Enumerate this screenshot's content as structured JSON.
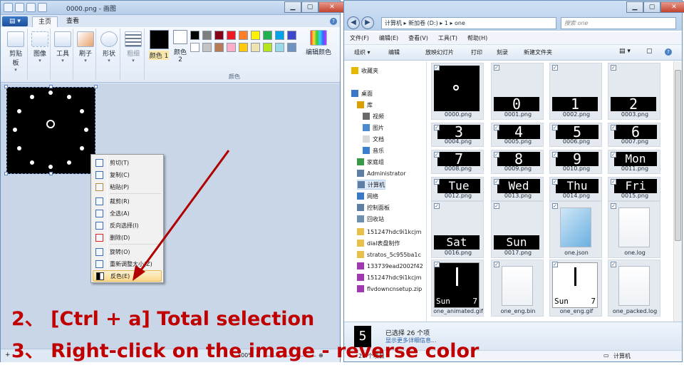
{
  "paint": {
    "title": "0000.png - 画图",
    "tabs": {
      "file": "",
      "home": "主页",
      "view": "查看"
    },
    "ribbon": {
      "clipboard": "剪贴板",
      "image": "图像",
      "tools": "工具",
      "brushes": "刷子",
      "shapes": "形状",
      "size": "粗细",
      "color1": "颜色 1",
      "color2": "颜色 2",
      "edit_colors": "编辑颜色",
      "colors_group": "颜色"
    },
    "palette": [
      "#000000",
      "#7f7f7f",
      "#880015",
      "#ed1c24",
      "#ff7f27",
      "#fff200",
      "#22b14c",
      "#00a2e8",
      "#3f48cc",
      "#ffffff",
      "#c3c3c3",
      "#b97a57",
      "#ffaec9",
      "#ffc90e",
      "#efe4b0",
      "#b5e61d",
      "#99d9ea",
      "#7092be"
    ],
    "status_zoom": "100%",
    "context_menu": [
      {
        "label": "剪切(T)",
        "icon": "scissors-icon"
      },
      {
        "label": "复制(C)",
        "icon": "copy-icon"
      },
      {
        "label": "粘贴(P)",
        "icon": "paste-icon"
      },
      {
        "label": "裁剪(R)",
        "icon": "crop-icon"
      },
      {
        "label": "全选(A)",
        "icon": "select-all-icon"
      },
      {
        "label": "反向选择(I)",
        "icon": "invert-selection-icon"
      },
      {
        "label": "删除(D)",
        "icon": "delete-icon"
      },
      {
        "label": "旋转(O)",
        "icon": "rotate-icon"
      },
      {
        "label": "重新调整大小(Z)",
        "icon": "resize-icon"
      },
      {
        "label": "反色(E)",
        "icon": "invert-color-icon"
      }
    ]
  },
  "explorer": {
    "address": "计算机 ▸ 新加卷 (D:) ▸ 1 ▸ one",
    "search_placeholder": "搜索 one",
    "menu": [
      "文件(F)",
      "编辑(E)",
      "查看(V)",
      "工具(T)",
      "帮助(H)"
    ],
    "toolbar": [
      "组织 ▾",
      "编辑",
      "放映幻灯片",
      "打印",
      "刻录",
      "新建文件夹"
    ],
    "nav": [
      {
        "label": "收藏夹",
        "indent": 0
      },
      {
        "label": "桌面",
        "indent": 0
      },
      {
        "label": "库",
        "indent": 1
      },
      {
        "label": "视频",
        "indent": 2
      },
      {
        "label": "图片",
        "indent": 2
      },
      {
        "label": "文档",
        "indent": 2
      },
      {
        "label": "音乐",
        "indent": 2
      },
      {
        "label": "家庭组",
        "indent": 1
      },
      {
        "label": "Administrator",
        "indent": 1
      },
      {
        "label": "计算机",
        "indent": 1
      },
      {
        "label": "网络",
        "indent": 1
      },
      {
        "label": "控制面板",
        "indent": 1
      },
      {
        "label": "回收站",
        "indent": 1
      },
      {
        "label": "151247hdc9i1kcjm",
        "indent": 1
      },
      {
        "label": "dial表盘制作",
        "indent": 1
      },
      {
        "label": "stratos_5c955ba1c",
        "indent": 1
      },
      {
        "label": "133739ead2002f42",
        "indent": 1
      },
      {
        "label": "151247hdc9i1kcjm",
        "indent": 1
      },
      {
        "label": "flvdowncnsetup.zip",
        "indent": 1
      }
    ],
    "files": [
      {
        "name": "0000.png",
        "thumb": ""
      },
      {
        "name": "0001.png",
        "thumb": "0"
      },
      {
        "name": "0002.png",
        "thumb": "1"
      },
      {
        "name": "0003.png",
        "thumb": "2"
      },
      {
        "name": "0004.png",
        "thumb": "3"
      },
      {
        "name": "0005.png",
        "thumb": "4"
      },
      {
        "name": "0006.png",
        "thumb": "5"
      },
      {
        "name": "0007.png",
        "thumb": "6"
      },
      {
        "name": "0008.png",
        "thumb": "7"
      },
      {
        "name": "0009.png",
        "thumb": "8"
      },
      {
        "name": "0010.png",
        "thumb": "9"
      },
      {
        "name": "0011.png",
        "thumb": "Mon"
      },
      {
        "name": "0012.png",
        "thumb": "Tue"
      },
      {
        "name": "0013.png",
        "thumb": "Wed"
      },
      {
        "name": "0014.png",
        "thumb": "Thu"
      },
      {
        "name": "0015.png",
        "thumb": "Fri"
      },
      {
        "name": "0016.png",
        "thumb": "Sat"
      },
      {
        "name": "0017.png",
        "thumb": "Sun"
      },
      {
        "name": "one.json",
        "thumb": ""
      },
      {
        "name": "one.log",
        "thumb": ""
      },
      {
        "name": "one_animated.gif",
        "thumb": "Sun 7"
      },
      {
        "name": "one_eng.bin",
        "thumb": ""
      },
      {
        "name": "one_eng.gif",
        "thumb": "Sun 7"
      },
      {
        "name": "one_packed.log",
        "thumb": ""
      }
    ],
    "details": {
      "selected": "已选择 26 个项",
      "show_more": "显示更多详细信息...",
      "preview_digit": "5"
    },
    "status": {
      "count": "26 个项目",
      "location": "计算机"
    }
  },
  "annotations": {
    "step2": "2、 [Ctrl + a] Total selection",
    "step3": "3、 Right-click on the image - reverse color"
  },
  "colors": {
    "annotation": "#c00000",
    "arrow": "#b00000"
  }
}
